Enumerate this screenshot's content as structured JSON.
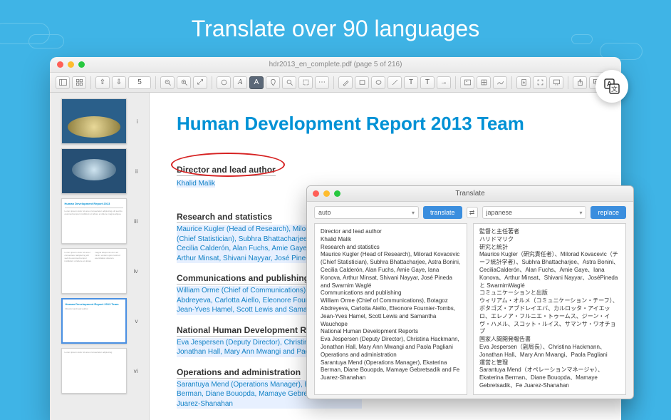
{
  "headline": "Translate over 90 languages",
  "window": {
    "title": "hdr2013_en_complete.pdf (page 5 of 216)",
    "page_number": "5"
  },
  "thumbnails": [
    "i",
    "ii",
    "iii",
    "iv",
    "v",
    "vi"
  ],
  "document": {
    "title": "Human Development Report 2013 Team",
    "sections": [
      {
        "heading": "Director and lead author",
        "body": "Khalid Malik"
      },
      {
        "heading": "Research and statistics",
        "body": "Maurice Kugler (Head of Research), Milorad Kovacevic (Chief Statistician), Subhra Bhattacharjee, Astra Bonini, Cecilia Calderón, Alan Fuchs, Amie Gaye, Iana Konova, Arthur Minsat, Shivani Nayyar, José Pineda and Swarnim"
      },
      {
        "heading": "Communications and publishing",
        "body": "William Orme (Chief of Communications), Botagoz Abdreyeva, Carlotta Aiello, Eleonore Fournier-Tombs, Jean-Yves Hamel, Scott Lewis and Samantha Wauchope"
      },
      {
        "heading": "National Human Development Reports",
        "body": "Eva Jespersen (Deputy Director), Christina Hackmann, Jonathan Hall, Mary Ann Mwangi and Paola Pagliani"
      },
      {
        "heading": "Operations and administration",
        "body": "Sarantuya Mend (Operations Manager), Ekaterina Berman, Diane Bouopda, Mamaye Gebretsadik and Fe Juarez-Shanahan"
      }
    ]
  },
  "translate": {
    "title": "Translate",
    "source_lang": "auto",
    "target_lang": "japanese",
    "translate_btn": "translate",
    "replace_btn": "replace",
    "source_text": [
      "Director and lead author",
      "Khalid Malik",
      "Research and statistics",
      "Maurice Kugler (Head of Research), Milorad Kovacevic (Chief Statistician), Subhra Bhattacharjee, Astra Bonini, Cecilia Calderón, Alan Fuchs, Amie Gaye, Iana Konova, Arthur Minsat, Shivani Nayyar, José Pineda and Swarnim Waglé",
      "Communications and publishing",
      "William Orme (Chief of Communications), Botagoz Abdreyeva, Carlotta Aiello, Eleonore Fournier-Tombs, Jean-Yves Hamel, Scott Lewis and Samantha Wauchope",
      "National Human Development Reports",
      "Eva Jespersen (Deputy Director), Christina Hackmann, Jonathan Hall, Mary Ann Mwangi and Paola Pagliani",
      "Operations and administration",
      "Sarantuya Mend (Operations Manager), Ekaterina Berman, Diane Bouopda, Mamaye Gebretsadik and Fe Juarez-Shanahan"
    ],
    "target_text": [
      "監督と主任著者",
      "ハリドマリク",
      "研究と統計",
      "Maurice Kugler（研究責任者）、Milorad Kovacevic（チーフ統計学者）、Subhra Bhattacharjee、Astra Bonini、CeciliaCalderón、Alan Fuchs、Amie Gaye、Iana Konova、Arthur Minsat、Shivani Nayyar、JoséPinedaと SwarnimWaglé",
      "コミュニケーションと出版",
      "ウィリアム・オルメ（コミュニケーション・チーフ）、ボタゴズ・アブドレイエバ、カルロッタ・アイエッロ、エレノア・フルニエ・トゥームス、ジーン・イヴ・ハメル、スコット・ルイス、サマンサ・ワオチョプ",
      "国家人間開発報告書",
      "Eva Jespersen（副局長）、Christina Hackmann、Jonathan Hall、Mary Ann Mwangi、Paola Pagliani",
      "運営と管理",
      "Sarantuya Mend（オペレーションマネージャ）、Ekaterina Berman、Diane Bouopda、Mamaye Gebretsadik、Fe Juarez-Shanahan"
    ]
  }
}
